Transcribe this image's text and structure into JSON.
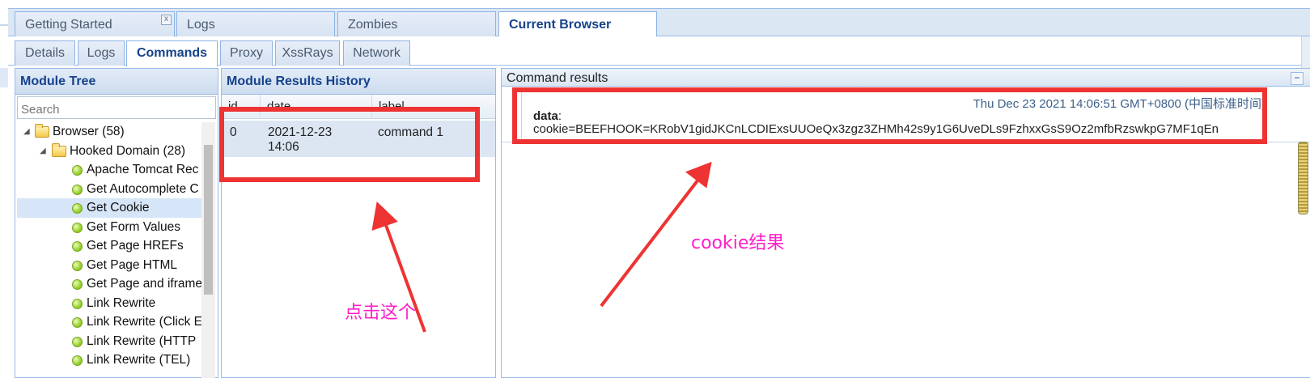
{
  "main_tabs": [
    {
      "label": "Getting Started",
      "close": "x"
    },
    {
      "label": "Logs"
    },
    {
      "label": "Zombies"
    },
    {
      "label": "Current Browser"
    }
  ],
  "sub_tabs": [
    "Details",
    "Logs",
    "Commands",
    "Proxy",
    "XssRays",
    "Network"
  ],
  "module_tree": {
    "title": "Module Tree",
    "search_placeholder": "Search",
    "items": [
      {
        "label": "Browser (58)"
      },
      {
        "label": "Hooked Domain (28)"
      },
      {
        "label": "Apache Tomcat Rec"
      },
      {
        "label": "Get Autocomplete C"
      },
      {
        "label": "Get Cookie"
      },
      {
        "label": "Get Form Values"
      },
      {
        "label": "Get Page HREFs"
      },
      {
        "label": "Get Page HTML"
      },
      {
        "label": "Get Page and iframe"
      },
      {
        "label": "Link Rewrite"
      },
      {
        "label": "Link Rewrite (Click E"
      },
      {
        "label": "Link Rewrite (HTTP"
      },
      {
        "label": "Link Rewrite (TEL)"
      }
    ]
  },
  "results_history": {
    "title": "Module Results History",
    "columns": [
      "id",
      "date",
      "label"
    ],
    "rows": [
      {
        "id": "0",
        "date_line1": "2021-12-23",
        "date_line2": "14:06",
        "label": "command 1"
      }
    ]
  },
  "command_results": {
    "title": "Command results",
    "collapse": "−",
    "timestamp": "Thu Dec 23 2021 14:06:51 GMT+0800 (中国标准时间)",
    "key": "data",
    "colon": ":",
    "value": "cookie=BEEFHOOK=KRobV1gidJKCnLCDIExsUUOeQx3zgz3ZHMh42s9y1G6UveDLs9FzhxxGsS9Oz2mfbRzswkpG7MF1qEn"
  },
  "annotations": {
    "click_here": "点击这个",
    "cookie_result": "cookie结果"
  },
  "colors": {
    "header_text": "#15428b",
    "annotation_box": "#ee3333",
    "annotation_text": "#ff1ec8"
  }
}
